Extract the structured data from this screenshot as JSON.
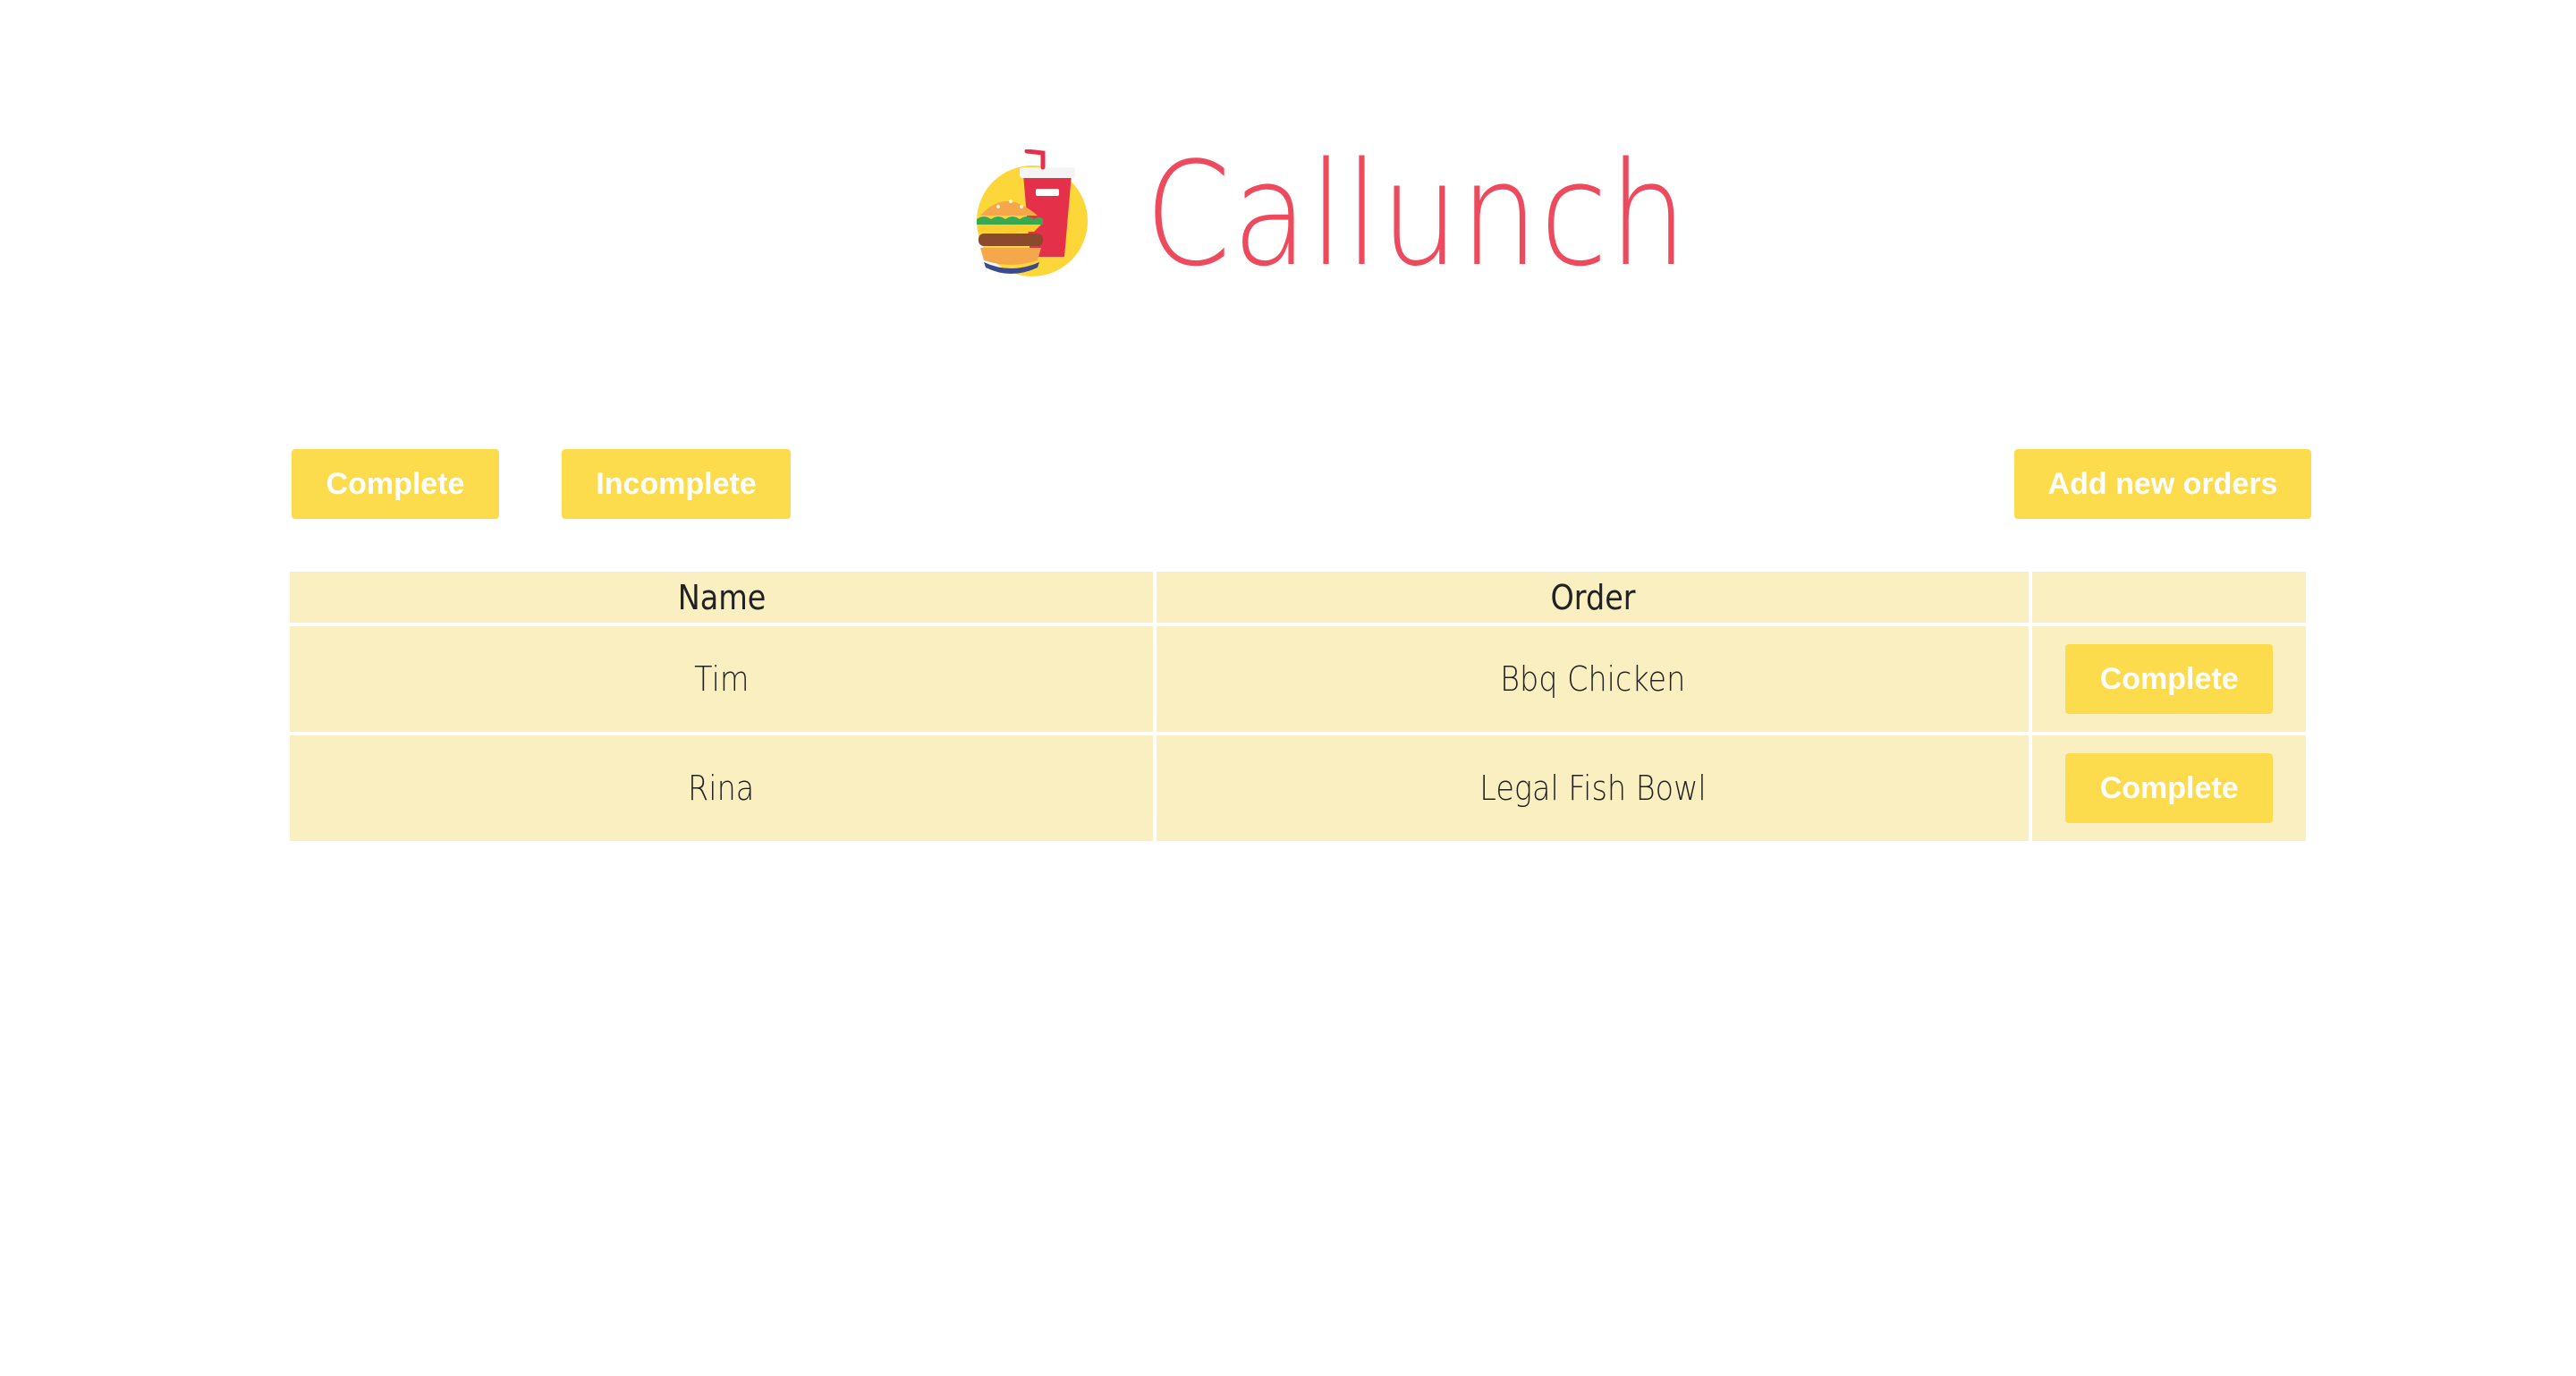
{
  "app": {
    "title": "Callunch",
    "logo_icon": "burger-and-soda-icon"
  },
  "filters": {
    "complete_label": "Complete",
    "incomplete_label": "Incomplete",
    "add_label": "Add new orders"
  },
  "table": {
    "headers": [
      "Name",
      "Order",
      ""
    ],
    "rows": [
      {
        "name": "Tim",
        "order": "Bbq Chicken",
        "action": "Complete"
      },
      {
        "name": "Rina",
        "order": "Legal Fish Bowl",
        "action": "Complete"
      }
    ]
  },
  "colors": {
    "brand": "#ee4a5e",
    "button": "#fcdc4d",
    "table_cell": "#faefc0"
  }
}
